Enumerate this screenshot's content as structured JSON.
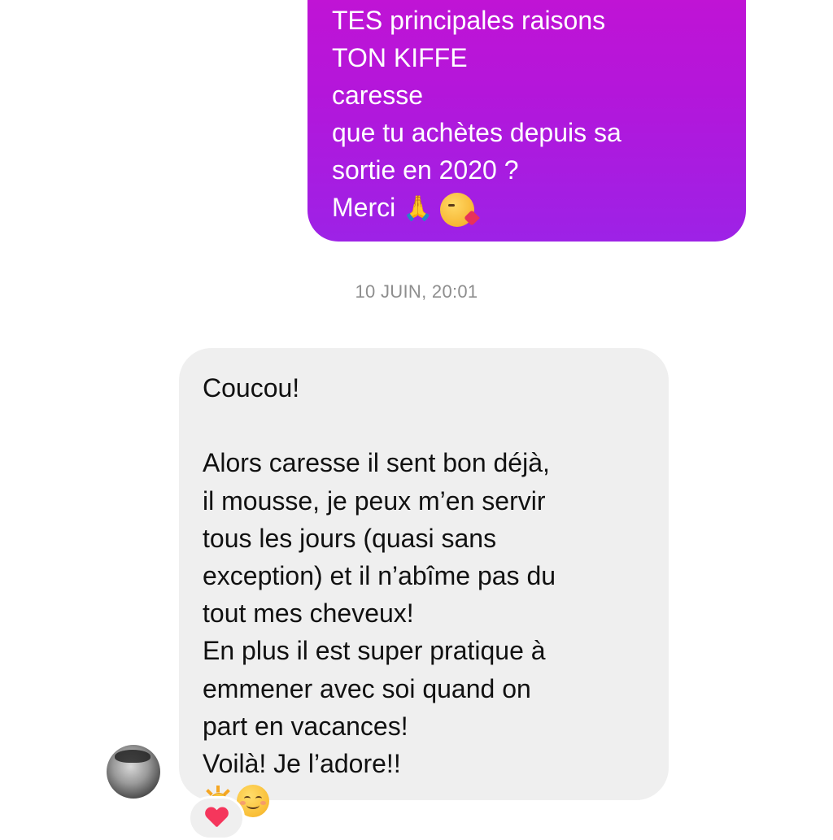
{
  "thread": {
    "outgoing_message": {
      "lines": [
        "TES principales raisons",
        "TON KIFFE",
        "caresse",
        "que tu achètes depuis sa",
        "sortie en 2020 ?",
        "Merci"
      ],
      "emojis": [
        "folded-hands",
        "face-blowing-kiss"
      ]
    },
    "timestamp": "10 JUIN, 20:01",
    "incoming_message": {
      "lines": [
        "Coucou!",
        "",
        "Alors caresse il sent bon déjà,",
        "il mousse, je peux m’en servir",
        "tous les jours (quasi sans",
        "exception) et il n’abîme pas du",
        "tout mes cheveux!",
        "En plus il est super pratique à",
        "emmener avec soi quand on",
        "part en vacances!",
        "Voilà! Je l’adore!!"
      ],
      "emojis": [
        "sun",
        "smiling-face"
      ]
    },
    "reaction": {
      "emoji": "red-heart"
    }
  },
  "colors": {
    "outgoing_gradient_top": "#c413d3",
    "outgoing_gradient_bottom": "#9d22e6",
    "incoming_bubble": "#efefef",
    "timestamp_text": "#8e8e8e",
    "heart": "#f5365c"
  }
}
